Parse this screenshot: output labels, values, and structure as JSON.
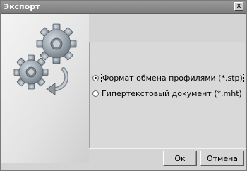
{
  "window": {
    "title": "Экспорт",
    "close_glyph": "x"
  },
  "options": [
    {
      "label": "Формат обмена профилями (*.stp)",
      "checked": true
    },
    {
      "label": "Гипертекстовый документ (*.mht)",
      "checked": false
    }
  ],
  "buttons": {
    "ok": "Ок",
    "cancel": "Отмена"
  },
  "icons": {
    "art": "gears-cycle-icon"
  },
  "colors": {
    "titlebar": "#8a8a8a",
    "panel": "#d4d4d4",
    "gear": "#9ea7b0"
  }
}
